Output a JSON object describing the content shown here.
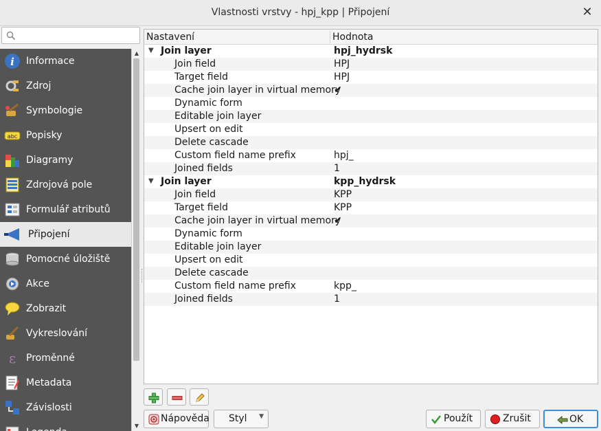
{
  "window": {
    "title": "Vlastnosti vrstvy - hpj_kpp | Připojení"
  },
  "search": {
    "placeholder": ""
  },
  "sidebar": {
    "items": [
      {
        "label": "Informace",
        "icon": "info-icon"
      },
      {
        "label": "Zdroj",
        "icon": "source-icon"
      },
      {
        "label": "Symbologie",
        "icon": "symbology-icon"
      },
      {
        "label": "Popisky",
        "icon": "labels-icon"
      },
      {
        "label": "Diagramy",
        "icon": "diagram-icon"
      },
      {
        "label": "Zdrojová pole",
        "icon": "source-fields-icon"
      },
      {
        "label": "Formulář atributů",
        "icon": "attribute-form-icon"
      },
      {
        "label": "Připojení",
        "icon": "join-icon",
        "active": true
      },
      {
        "label": "Pomocné úložiště",
        "icon": "auxiliary-storage-icon"
      },
      {
        "label": "Akce",
        "icon": "actions-icon"
      },
      {
        "label": "Zobrazit",
        "icon": "display-icon"
      },
      {
        "label": "Vykreslování",
        "icon": "rendering-icon"
      },
      {
        "label": "Proměnné",
        "icon": "variables-icon"
      },
      {
        "label": "Metadata",
        "icon": "metadata-icon"
      },
      {
        "label": "Závislosti",
        "icon": "dependencies-icon"
      },
      {
        "label": "Legenda",
        "icon": "legend-icon"
      }
    ]
  },
  "table": {
    "headers": {
      "setting": "Nastavení",
      "value": "Hodnota"
    },
    "groups": [
      {
        "label": "Join layer",
        "value": "hpj_hydrsk",
        "rows": [
          {
            "key": "Join field",
            "value": "HPJ"
          },
          {
            "key": "Target field",
            "value": "HPJ"
          },
          {
            "key": "Cache join layer in virtual memory",
            "value": "✔"
          },
          {
            "key": "Dynamic form",
            "value": ""
          },
          {
            "key": "Editable join layer",
            "value": ""
          },
          {
            "key": "Upsert on edit",
            "value": ""
          },
          {
            "key": "Delete cascade",
            "value": ""
          },
          {
            "key": "Custom field name prefix",
            "value": "hpj_"
          },
          {
            "key": "Joined fields",
            "value": "1"
          }
        ]
      },
      {
        "label": "Join layer",
        "value": "kpp_hydrsk",
        "rows": [
          {
            "key": "Join field",
            "value": "KPP"
          },
          {
            "key": "Target field",
            "value": "KPP"
          },
          {
            "key": "Cache join layer in virtual memory",
            "value": "✔"
          },
          {
            "key": "Dynamic form",
            "value": ""
          },
          {
            "key": "Editable join layer",
            "value": ""
          },
          {
            "key": "Upsert on edit",
            "value": ""
          },
          {
            "key": "Delete cascade",
            "value": ""
          },
          {
            "key": "Custom field name prefix",
            "value": "kpp_"
          },
          {
            "key": "Joined fields",
            "value": "1"
          }
        ]
      }
    ]
  },
  "toolbar": {
    "add": "add-join-icon",
    "remove": "remove-join-icon",
    "edit": "edit-join-icon"
  },
  "buttons": {
    "help": "Nápověda",
    "style": "Styl",
    "apply": "Použít",
    "cancel": "Zrušit",
    "ok": "OK"
  },
  "colors": {
    "sidebar_bg": "#545454",
    "accent": "#3d8fd9"
  }
}
